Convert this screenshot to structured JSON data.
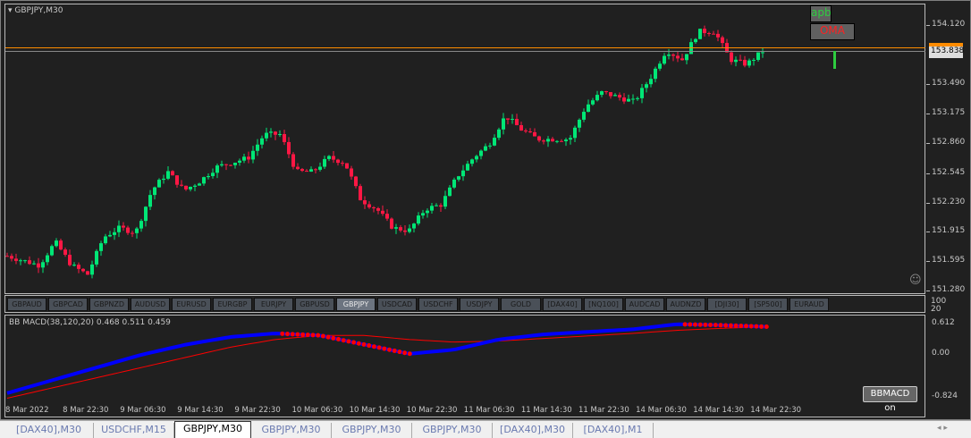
{
  "chart": {
    "title": "GBPJPY,M30",
    "current_price": "153.838",
    "indicator_label": "BB MACD(38,120,20) 0.468 0.511 0.459",
    "buttons": {
      "apb": "apb",
      "oma": "OMA",
      "bbmacd": "BBMACD on"
    },
    "price_labels": [
      "154.120",
      "153.490",
      "153.175",
      "152.860",
      "152.545",
      "152.230",
      "151.915",
      "151.595",
      "151.280"
    ],
    "sym_scale": [
      "100",
      "20"
    ],
    "macd_labels": [
      "0.612",
      "0.00",
      "-0.824"
    ],
    "time_labels": [
      "8 Mar 2022",
      "8 Mar 22:30",
      "9 Mar 06:30",
      "9 Mar 14:30",
      "9 Mar 22:30",
      "10 Mar 06:30",
      "10 Mar 14:30",
      "10 Mar 22:30",
      "11 Mar 06:30",
      "11 Mar 14:30",
      "11 Mar 22:30",
      "14 Mar 06:30",
      "14 Mar 14:30",
      "14 Mar 22:30"
    ],
    "colors": {
      "bull": "#00e676",
      "bear": "#ff1744",
      "macd": "#0000ff",
      "signal": "#ff0000",
      "current": "#ff8c00"
    }
  },
  "symbols": [
    {
      "label": "GBPAUD"
    },
    {
      "label": "GBPCAD"
    },
    {
      "label": "GBPNZD"
    },
    {
      "label": "AUDUSD"
    },
    {
      "label": "EURUSD"
    },
    {
      "label": "EURGBP"
    },
    {
      "label": "EURJPY"
    },
    {
      "label": "GBPUSD"
    },
    {
      "label": "GBPJPY",
      "active": true
    },
    {
      "label": "USDCAD"
    },
    {
      "label": "USDCHF"
    },
    {
      "label": "USDJPY"
    },
    {
      "label": "GOLD"
    },
    {
      "label": "[DAX40]"
    },
    {
      "label": "[NQ100]"
    },
    {
      "label": "AUDCAD"
    },
    {
      "label": "AUDNZD"
    },
    {
      "label": "[DJI30]"
    },
    {
      "label": "[SP500]"
    },
    {
      "label": "EURAUD"
    }
  ],
  "tabs": [
    {
      "label": "[DAX40],M30"
    },
    {
      "label": "USDCHF,M15"
    },
    {
      "label": "GBPJPY,M30",
      "active": true
    },
    {
      "label": "GBPJPY,M30"
    },
    {
      "label": "GBPJPY,M30"
    },
    {
      "label": "GBPJPY,M30"
    },
    {
      "label": "[DAX40],M30"
    },
    {
      "label": "[DAX40],M1"
    }
  ],
  "chart_data": {
    "type": "candlestick",
    "symbol": "GBPJPY",
    "timeframe": "M30",
    "ylim": [
      151.28,
      154.12
    ],
    "approx_close": [
      151.65,
      151.6,
      151.55,
      151.8,
      151.55,
      151.45,
      151.85,
      151.95,
      151.9,
      152.35,
      152.55,
      152.35,
      152.45,
      152.6,
      152.65,
      152.7,
      152.95,
      152.95,
      152.55,
      152.55,
      152.7,
      152.65,
      152.25,
      152.15,
      151.95,
      151.92,
      152.15,
      152.2,
      152.5,
      152.7,
      152.85,
      153.15,
      153.0,
      152.9,
      152.9,
      152.9,
      153.25,
      153.4,
      153.35,
      153.3,
      153.55,
      153.85,
      153.75,
      154.05,
      154.05,
      153.75,
      153.7,
      153.84
    ],
    "macd_ylim": [
      -0.824,
      0.612
    ],
    "macd_approx": [
      -0.75,
      -0.5,
      -0.25,
      0.0,
      0.2,
      0.35,
      0.42,
      0.38,
      0.2,
      0.02,
      0.1,
      0.3,
      0.4,
      0.45,
      0.5,
      0.6,
      0.58,
      0.55
    ],
    "signal_approx": [
      -0.85,
      -0.65,
      -0.45,
      -0.25,
      -0.05,
      0.15,
      0.3,
      0.38,
      0.38,
      0.3,
      0.25,
      0.27,
      0.32,
      0.37,
      0.42,
      0.48,
      0.52,
      0.55
    ]
  }
}
